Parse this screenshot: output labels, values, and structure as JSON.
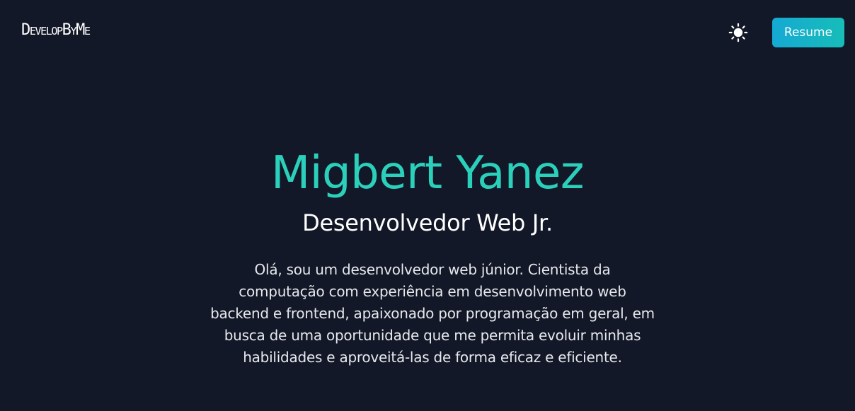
{
  "header": {
    "brand": "DevelopByMe",
    "theme_toggle_icon": "sun-icon",
    "resume_label": "Resume"
  },
  "hero": {
    "name": "Migbert Yanez",
    "title": "Desenvolvedor Web Jr.",
    "bio": "Olá, sou um desenvolvedor web júnior. Cientista da computação com experiência em desenvolvimento web backend e frontend, apaixonado por programação em geral, em busca de uma oportunidade que me permita evoluir minhas habilidades e aproveitá-las de forma eficaz e eficiente."
  },
  "colors": {
    "background": "#121828",
    "accent": "#2bd0bb",
    "button_gradient_start": "#15a9d4",
    "button_gradient_end": "#17bdb8",
    "text_primary": "#ffffff",
    "text_secondary": "#e6e8ec"
  }
}
